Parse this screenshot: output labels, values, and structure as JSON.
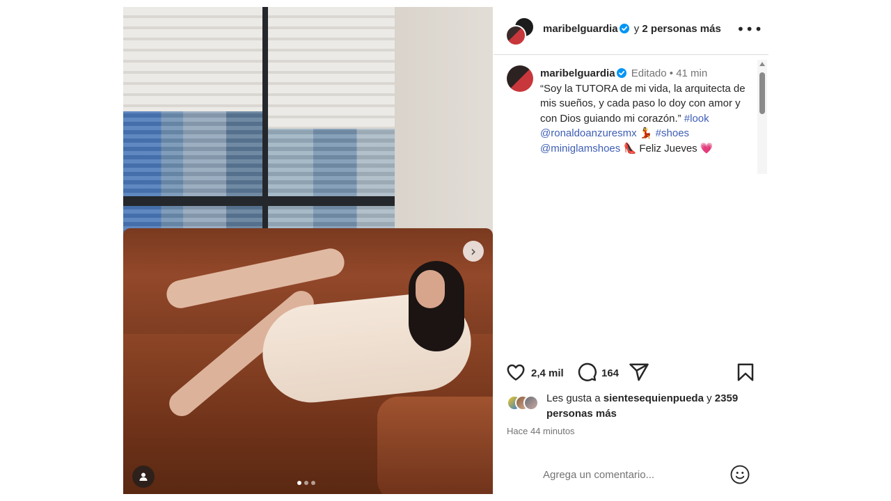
{
  "header": {
    "username": "maribelguardia",
    "coauthors_text": "y",
    "coauthors_more": "2 personas más",
    "more_icon": "more-horizontal-icon"
  },
  "caption": {
    "username": "maribelguardia",
    "edited": "Editado",
    "separator": "•",
    "time": "41 min",
    "text_1": "“Soy la TUTORA  de mi vida, la arquitecta de mis sueños, y cada paso lo doy con amor y con Dios guiando mi corazón.” ",
    "tag_look": "#look",
    "mention_1": "@ronaldoanzuresmx",
    "emoji_1": "💃",
    "tag_shoes": "#shoes",
    "mention_2": "@miniglamshoes",
    "emoji_2": "👠",
    "text_2": "Feliz Jueves",
    "emoji_3": "💗"
  },
  "actions": {
    "like_count": "2,4 mil",
    "comment_count": "164",
    "icons": [
      "heart-icon",
      "comment-icon",
      "share-icon",
      "bookmark-icon"
    ]
  },
  "likes": {
    "prefix": "Les gusta a",
    "user": "sientesequienpueda",
    "connector": "y",
    "others": "2359 personas más"
  },
  "time_ago": "Hace 44 minutos",
  "comment": {
    "placeholder": "Agrega un comentario...",
    "emoji_icon": "smiley-icon"
  },
  "carousel": {
    "current_index": 1,
    "total": 3
  },
  "colors": {
    "verified_blue": "#0095f6",
    "link_blue": "#3e5eb5",
    "text": "#262626",
    "secondary": "#737373"
  }
}
